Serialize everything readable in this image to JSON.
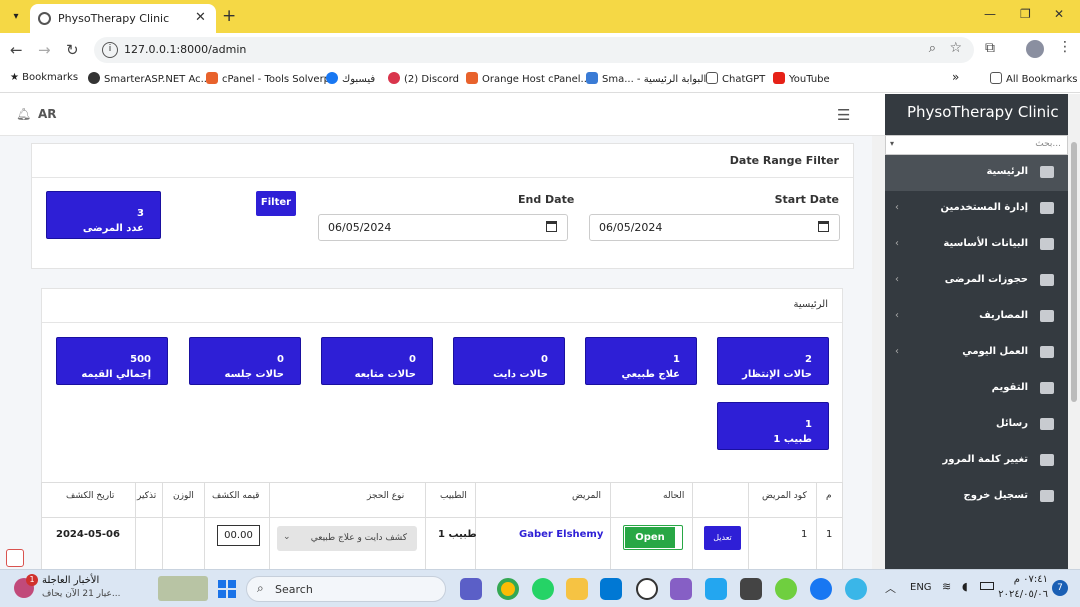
{
  "browser": {
    "tab_title": "PhysoTherapy Clinic",
    "url": "127.0.0.1:8000/admin",
    "bookmarks": [
      {
        "label": "Bookmarks",
        "icon": "star-icon",
        "color": "#222222"
      },
      {
        "label": "SmarterASP.NET Ac...",
        "icon": "smarterasp-icon",
        "color": "#333333"
      },
      {
        "label": "cPanel - Tools Solverp",
        "icon": "cpanel-icon",
        "color": "#e8622c"
      },
      {
        "label": "فيسبوك",
        "icon": "facebook-icon",
        "color": "#1877f2"
      },
      {
        "label": "(2) Discord",
        "icon": "discord-icon",
        "color": "#d9354c"
      },
      {
        "label": "Orange Host cPanel...",
        "icon": "cpanel-icon",
        "color": "#e8622c"
      },
      {
        "label": "Sma... - البوابة الرئيسية",
        "icon": "portal-icon",
        "color": "#3a7bd5"
      },
      {
        "label": "ChatGPT",
        "icon": "chatgpt-icon",
        "color": "#555555"
      },
      {
        "label": "YouTube",
        "icon": "youtube-icon",
        "color": "#e62117"
      }
    ],
    "all_bookmarks": "All Bookmarks"
  },
  "topbar": {
    "lang": "AR"
  },
  "filter": {
    "title": "Date Range Filter",
    "start_label": "Start Date",
    "start_value": "06/05/2024",
    "end_label": "End Date",
    "end_value": "06/05/2024",
    "button": "Filter",
    "patients_count": "3",
    "patients_label": "عدد المرضى"
  },
  "main": {
    "title": "الرئيسية",
    "stats": [
      {
        "num": "2",
        "label": "حالات الإنتظار"
      },
      {
        "num": "1",
        "label": "علاج طبيعي"
      },
      {
        "num": "0",
        "label": "حالات دايت"
      },
      {
        "num": "0",
        "label": "حالات متابعه"
      },
      {
        "num": "0",
        "label": "حالات جلسه"
      },
      {
        "num": "500",
        "label": "إجمالي القيمه"
      }
    ],
    "doctor_stat": {
      "num": "1",
      "label": "طبيب 1"
    }
  },
  "table": {
    "headers": [
      "م",
      "كود المريض",
      "",
      "الحاله",
      "المريض",
      "الطبيب",
      "نوع الحجز",
      "قيمه الكشف",
      "الوزن",
      "تذكير",
      "تاريخ الكشف"
    ],
    "row": {
      "index": "1",
      "code": "1",
      "edit_label": "تعديل",
      "status": "Open",
      "patient": "Gaber Elshemy",
      "doctor": "طبيب 1",
      "booking_type": "كشف دايت و علاج طبيعي",
      "fee": "00.00",
      "weight": "",
      "reminder": "",
      "date": "2024-05-06"
    }
  },
  "sidebar": {
    "brand": "PhysoTherapy Clinic",
    "search_placeholder": "بحث...",
    "items": [
      {
        "label": "الرئيسية",
        "icon": "dashboard-icon",
        "active": true,
        "has_children": false
      },
      {
        "label": "إدارة المستخدمين",
        "icon": "users-icon",
        "active": false,
        "has_children": true
      },
      {
        "label": "البيانات الأساسية",
        "icon": "cogs-icon",
        "active": false,
        "has_children": true
      },
      {
        "label": "حجوزات المرضى",
        "icon": "list-icon",
        "active": false,
        "has_children": true
      },
      {
        "label": "المصاريف",
        "icon": "money-icon",
        "active": false,
        "has_children": true
      },
      {
        "label": "العمل اليومي",
        "icon": "cogs-icon",
        "active": false,
        "has_children": true
      },
      {
        "label": "التقويم",
        "icon": "calendar-icon",
        "active": false,
        "has_children": false
      },
      {
        "label": "رسائل",
        "icon": "envelope-icon",
        "active": false,
        "has_children": false
      },
      {
        "label": "تغيير كلمة المرور",
        "icon": "key-icon",
        "active": false,
        "has_children": false
      },
      {
        "label": "تسجيل خروج",
        "icon": "sign-out-icon",
        "active": false,
        "has_children": false
      }
    ]
  },
  "taskbar": {
    "news_title": "الأخبار العاجلة",
    "news_sub": "عيار 21 الآن يحاف...",
    "news_badge": "1",
    "search_label": "Search",
    "lang": "ENG",
    "time": "٠٧:٤١ م",
    "date": "٢٠٢٤/٠٥/٠٦",
    "notif_count": "7"
  },
  "colors": {
    "accent": "#2e1fd6",
    "sidebar_bg": "#343a40",
    "tabbar": "#f5d845",
    "open_status": "#28a745"
  }
}
